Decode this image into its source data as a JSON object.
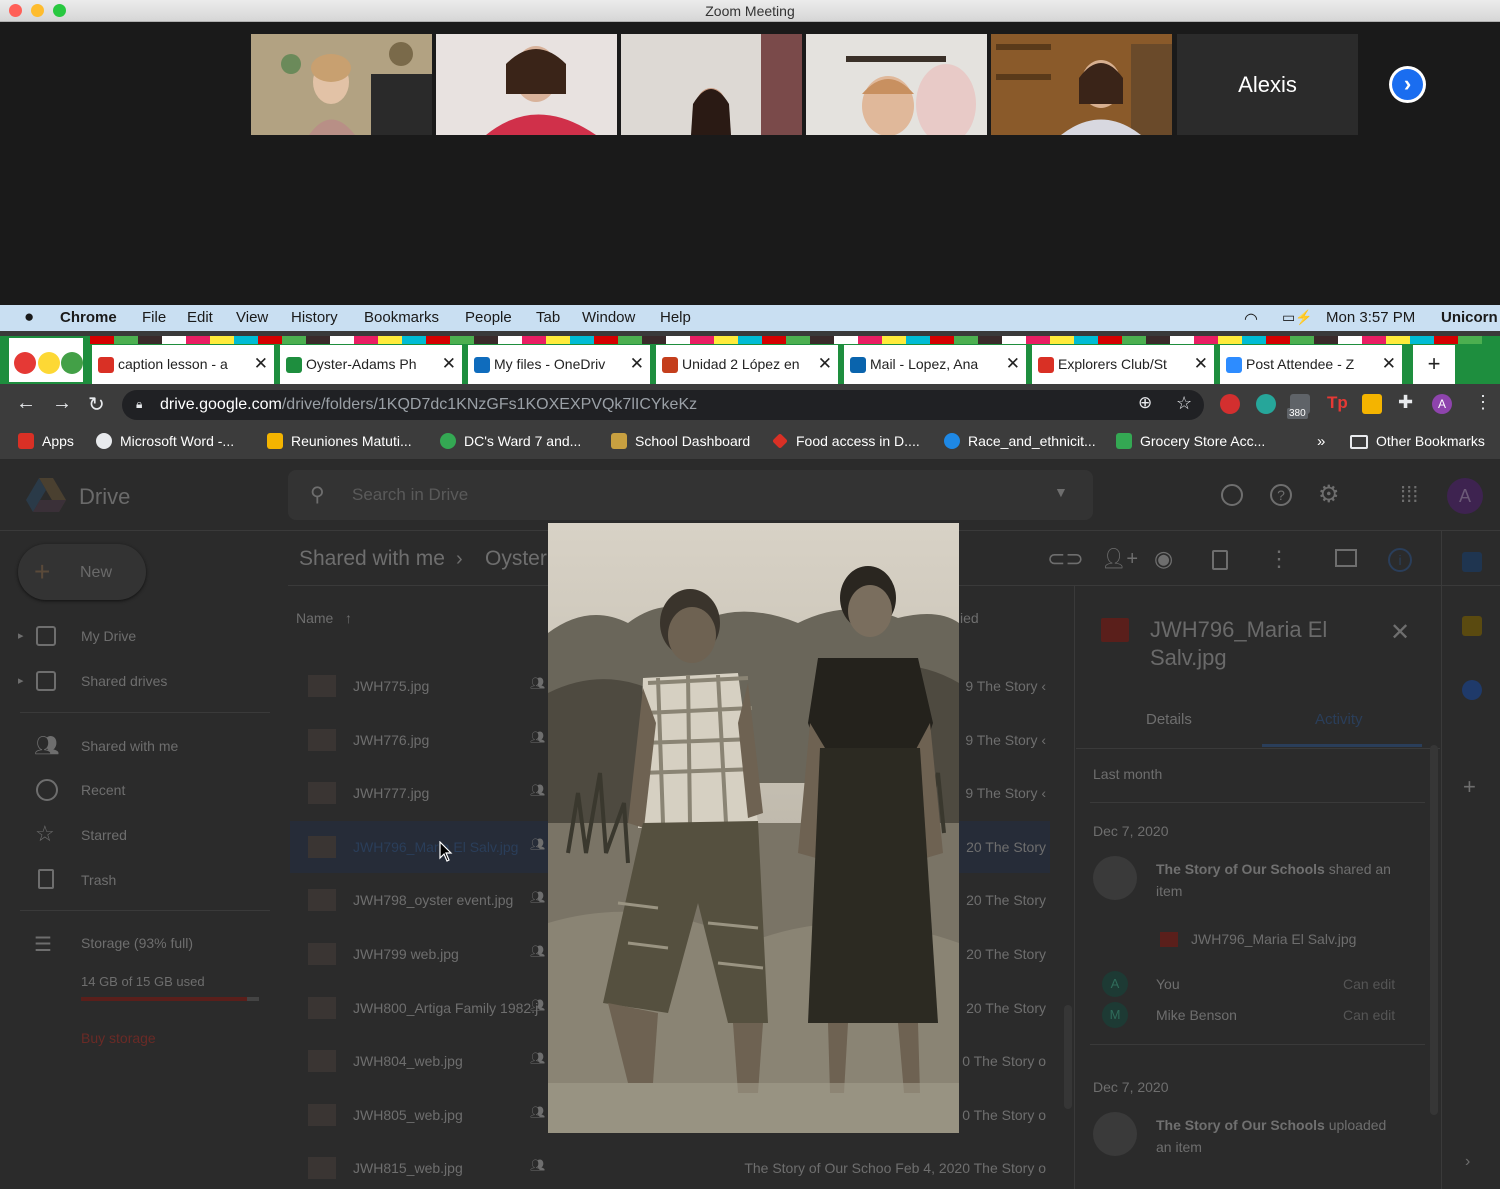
{
  "zoom": {
    "window_title": "Zoom Meeting",
    "participants": [
      {
        "name": ""
      },
      {
        "name": ""
      },
      {
        "name": ""
      },
      {
        "name": ""
      },
      {
        "name": ""
      },
      {
        "name": "Alexis"
      }
    ]
  },
  "menubar": {
    "app": "Chrome",
    "items": [
      "File",
      "Edit",
      "View",
      "History",
      "Bookmarks",
      "People",
      "Tab",
      "Window",
      "Help"
    ],
    "clock": "Mon 3:57 PM",
    "user": "Unicorn"
  },
  "tabs": [
    {
      "label": "caption lesson - a",
      "icon": "gmail-icon",
      "color": "#d93025"
    },
    {
      "label": "Oyster-Adams Ph",
      "icon": "drive-icon",
      "color": "#1e8e3e",
      "active": true
    },
    {
      "label": "My files - OneDriv",
      "icon": "onedrive-icon",
      "color": "#0f6cbd"
    },
    {
      "label": "Unidad 2 López en",
      "icon": "powerpoint-icon",
      "color": "#c43e1c"
    },
    {
      "label": "Mail - Lopez, Ana",
      "icon": "outlook-icon",
      "color": "#0a64ad"
    },
    {
      "label": "Explorers Club/St",
      "icon": "gmail-icon",
      "color": "#d93025"
    },
    {
      "label": "Post Attendee - Z",
      "icon": "zoom-icon",
      "color": "#2d8cff"
    }
  ],
  "address": {
    "domain": "drive.google.com",
    "path": "/drive/folders/1KQD7dc1KNzGFs1KOXEXPVQk7lICYkeKz",
    "badge": "380"
  },
  "bookmarks": [
    {
      "label": "Apps",
      "color": "#d93025"
    },
    {
      "label": "Microsoft Word -...",
      "color": "#e8eaed"
    },
    {
      "label": "Reuniones Matuti...",
      "color": "#f4b400"
    },
    {
      "label": "DC's Ward 7 and...",
      "color": "#34a853"
    },
    {
      "label": "School Dashboard",
      "color": "#c8a040"
    },
    {
      "label": "Food access in D....",
      "color": "#d93025"
    },
    {
      "label": "Race_and_ethnicit...",
      "color": "#1e88e5"
    },
    {
      "label": "Grocery Store Acc...",
      "color": "#34a853"
    },
    {
      "label": "»",
      "color": ""
    },
    {
      "label": "Other Bookmarks",
      "color": ""
    }
  ],
  "drive": {
    "brand": "Drive",
    "search_placeholder": "Search in Drive",
    "new_label": "New",
    "nav": [
      "My Drive",
      "Shared drives",
      "Shared with me",
      "Recent",
      "Starred",
      "Trash"
    ],
    "storage_label": "Storage (93% full)",
    "storage_used": "14 GB of 15 GB used",
    "storage_fraction": 0.93,
    "buy_storage": "Buy storage",
    "breadcrumb": [
      "Shared with me",
      "Oyster"
    ],
    "name_header": "Name",
    "modified_header_fragment": "ied",
    "files": [
      {
        "name": "JWH775.jpg",
        "meta": "9  The Story ‹"
      },
      {
        "name": "JWH776.jpg",
        "meta": "9  The Story ‹"
      },
      {
        "name": "JWH777.jpg",
        "meta": "9  The Story ‹"
      },
      {
        "name": "JWH796_Maria El Salv.jpg",
        "meta": "20  The Story",
        "selected": true
      },
      {
        "name": "JWH798_oyster event.jpg",
        "meta": "20  The Story"
      },
      {
        "name": "JWH799 web.jpg",
        "meta": "20  The Story"
      },
      {
        "name": "JWH800_Artiga Family 1982.j",
        "meta": "20  The Story"
      },
      {
        "name": "JWH804_web.jpg",
        "meta": "0  The Story o"
      },
      {
        "name": "JWH805_web.jpg",
        "meta": "0  The Story o"
      },
      {
        "name": "JWH815_web.jpg",
        "meta": "The Story of Our Schoo   Feb 4, 2020  The Story o"
      }
    ],
    "details": {
      "title": "JWH796_Maria El Salv.jpg",
      "tab_details": "Details",
      "tab_activity": "Activity",
      "period": "Last month",
      "events": [
        {
          "date": "Dec 7, 2020",
          "actor": "The Story of Our Schools",
          "action": "shared an item",
          "file": "JWH796_Maria El Salv.jpg",
          "people": [
            {
              "initial": "A",
              "name": "You",
              "role": "Can edit"
            },
            {
              "initial": "M",
              "name": "Mike Benson",
              "role": "Can edit"
            }
          ]
        },
        {
          "date": "Dec 7, 2020",
          "actor": "The Story of Our Schools",
          "action": "uploaded an item"
        }
      ]
    }
  },
  "colors": {
    "accent_blue": "#1a73e8",
    "tab_green": "#1e8e3e",
    "menubar": "#c9dff2"
  }
}
